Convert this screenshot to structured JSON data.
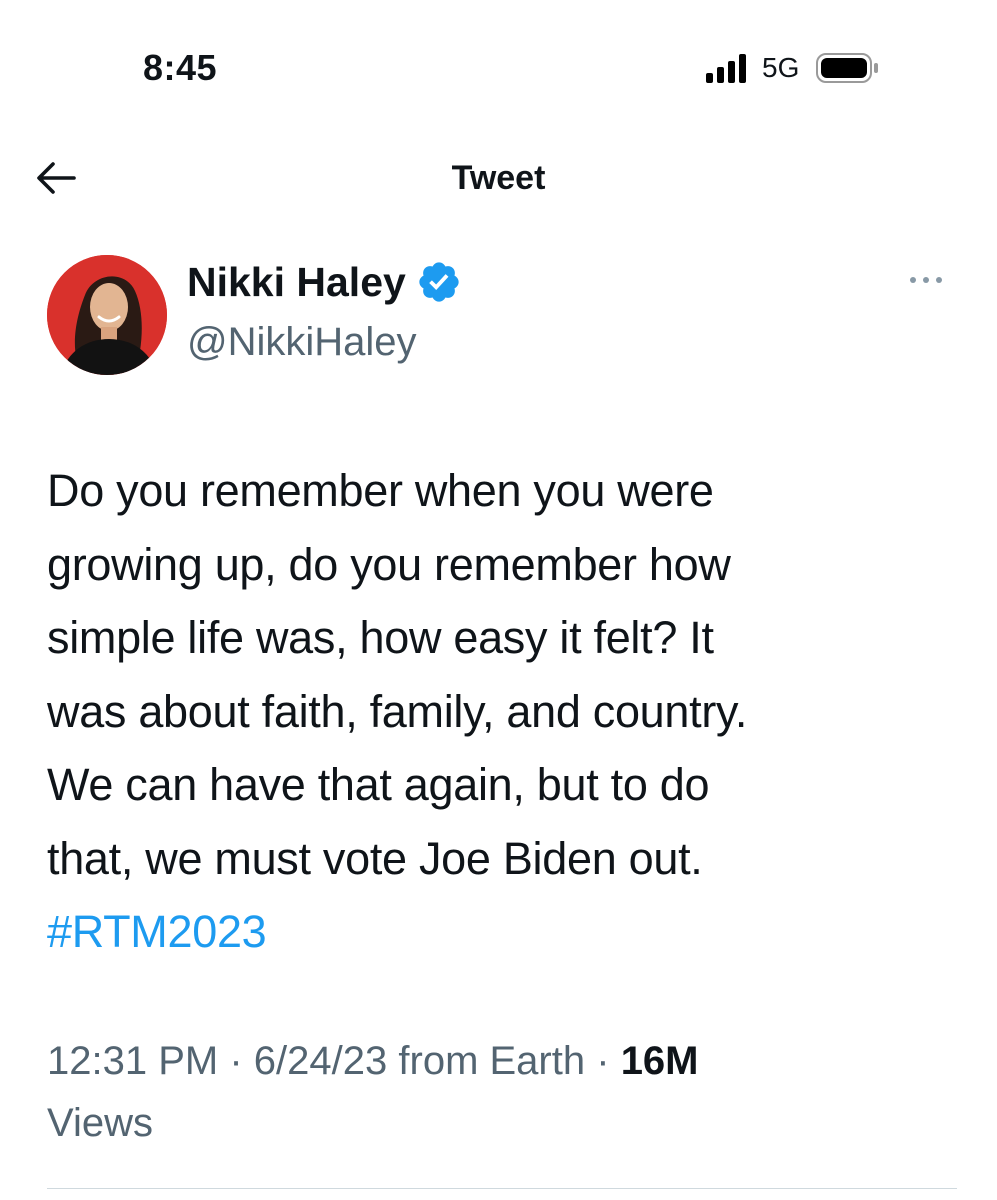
{
  "status_bar": {
    "time": "8:45",
    "network": "5G",
    "signal_bars": 4,
    "icons": [
      "signal-icon",
      "battery-icon"
    ]
  },
  "header": {
    "title": "Tweet",
    "back_icon": "arrow-left-icon"
  },
  "author": {
    "name": "Nikki Haley",
    "handle": "@NikkiHaley",
    "verified": true,
    "verified_icon": "verified-badge-icon",
    "avatar_bg_color": "#d9312c",
    "more_icon": "more-horizontal-icon"
  },
  "tweet": {
    "text": "Do you remember when you were\ngrowing up, do you remember how\nsimple life was, how easy it felt? It\nwas about faith, family, and country.\nWe can have that again, but to do\nthat, we must vote Joe Biden out.",
    "hashtag": "#RTM2023",
    "time": "12:31 PM",
    "separator": "·",
    "date": "6/24/23",
    "source": "from Earth",
    "views_count": "16M",
    "views_label": "Views"
  },
  "colors": {
    "text_primary": "#0f1419",
    "text_secondary": "#536471",
    "accent": "#1d9bf0",
    "divider": "#cfd9de"
  }
}
